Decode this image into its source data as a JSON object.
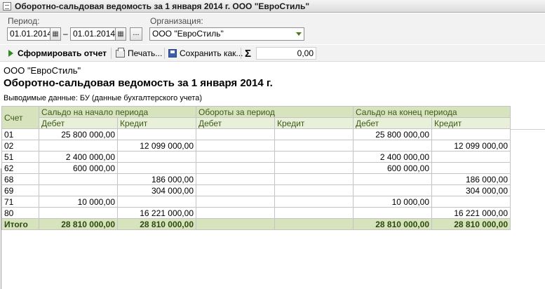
{
  "window": {
    "title": "Оборотно-сальдовая ведомость за 1 января 2014 г. ООО \"ЕвроСтиль\""
  },
  "params": {
    "period_label": "Период:",
    "date_from": "01.01.2014",
    "date_to": "01.01.2014",
    "dash": "–",
    "period_choose": "...",
    "org_label": "Организация:",
    "org_value": "ООО \"ЕвроСтиль\""
  },
  "toolbar": {
    "generate_label": "Сформировать отчет",
    "print_label": "Печать...",
    "save_label": "Сохранить как...",
    "sigma": "Σ",
    "sum_value": "0,00"
  },
  "report": {
    "org": "ООО \"ЕвроСтиль\"",
    "title": "Оборотно-сальдовая ведомость за 1 января 2014 г.",
    "shown_data": "Выводимые данные:  БУ (данные бухгалтерского учета)",
    "headers": {
      "account": "Счет",
      "opening": "Сальдо на начало периода",
      "turnover": "Обороты за период",
      "closing": "Сальдо на конец периода",
      "debit": "Дебет",
      "credit": "Кредит"
    },
    "rows": [
      {
        "account": "01",
        "ob_d": "25 800 000,00",
        "ob_c": "",
        "t_d": "",
        "t_c": "",
        "cb_d": "25 800 000,00",
        "cb_c": ""
      },
      {
        "account": "02",
        "ob_d": "",
        "ob_c": "12 099 000,00",
        "t_d": "",
        "t_c": "",
        "cb_d": "",
        "cb_c": "12 099 000,00"
      },
      {
        "account": "51",
        "ob_d": "2 400 000,00",
        "ob_c": "",
        "t_d": "",
        "t_c": "",
        "cb_d": "2 400 000,00",
        "cb_c": ""
      },
      {
        "account": "62",
        "ob_d": "600 000,00",
        "ob_c": "",
        "t_d": "",
        "t_c": "",
        "cb_d": "600 000,00",
        "cb_c": ""
      },
      {
        "account": "68",
        "ob_d": "",
        "ob_c": "186 000,00",
        "t_d": "",
        "t_c": "",
        "cb_d": "",
        "cb_c": "186 000,00"
      },
      {
        "account": "69",
        "ob_d": "",
        "ob_c": "304 000,00",
        "t_d": "",
        "t_c": "",
        "cb_d": "",
        "cb_c": "304 000,00"
      },
      {
        "account": "71",
        "ob_d": "10 000,00",
        "ob_c": "",
        "t_d": "",
        "t_c": "",
        "cb_d": "10 000,00",
        "cb_c": ""
      },
      {
        "account": "80",
        "ob_d": "",
        "ob_c": "16 221 000,00",
        "t_d": "",
        "t_c": "",
        "cb_d": "",
        "cb_c": "16 221 000,00"
      }
    ],
    "total": {
      "label": "Итого",
      "ob_d": "28 810 000,00",
      "ob_c": "28 810 000,00",
      "t_d": "",
      "t_c": "",
      "cb_d": "28 810 000,00",
      "cb_c": "28 810 000,00"
    }
  }
}
